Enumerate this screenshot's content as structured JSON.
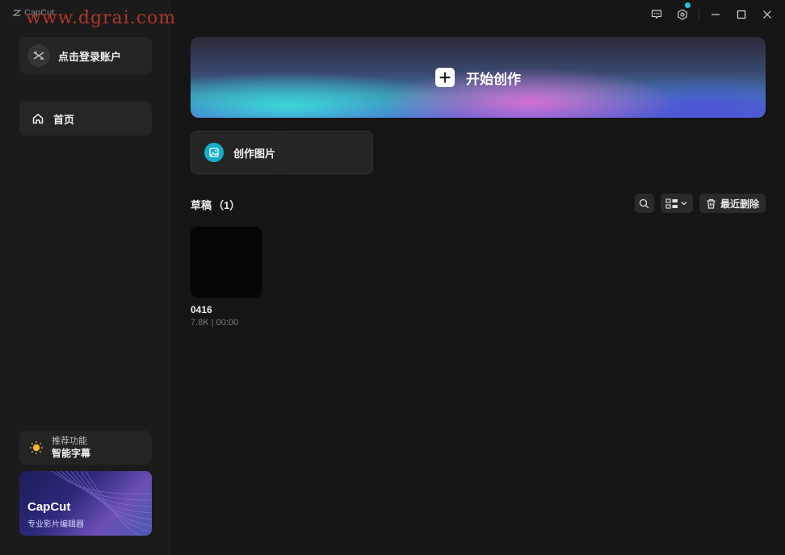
{
  "app": {
    "name": "CapCut",
    "watermark": "www.dgrai.com"
  },
  "sidebar": {
    "login_label": "点击登录账户",
    "nav": [
      {
        "label": "首页",
        "icon": "home-icon"
      }
    ],
    "feature": {
      "sub": "推荐功能",
      "main": "智能字幕",
      "icon": "lightbulb-icon"
    },
    "promo": {
      "title": "CapCut",
      "subtitle": "专业影片编辑器"
    }
  },
  "hero": {
    "label": "开始创作",
    "icon": "plus-icon"
  },
  "create_image": {
    "label": "创作图片",
    "icon": "image-icon"
  },
  "drafts": {
    "title": "草稿",
    "count": "（1）",
    "recently_deleted": "最近删除",
    "items": [
      {
        "name": "0416",
        "meta": "7.8K | 00:00"
      }
    ]
  },
  "colors": {
    "background": "#151515",
    "sidebar": "#1b1b1b",
    "accent": "#18aecb",
    "notification_dot": "#22c2d6"
  }
}
